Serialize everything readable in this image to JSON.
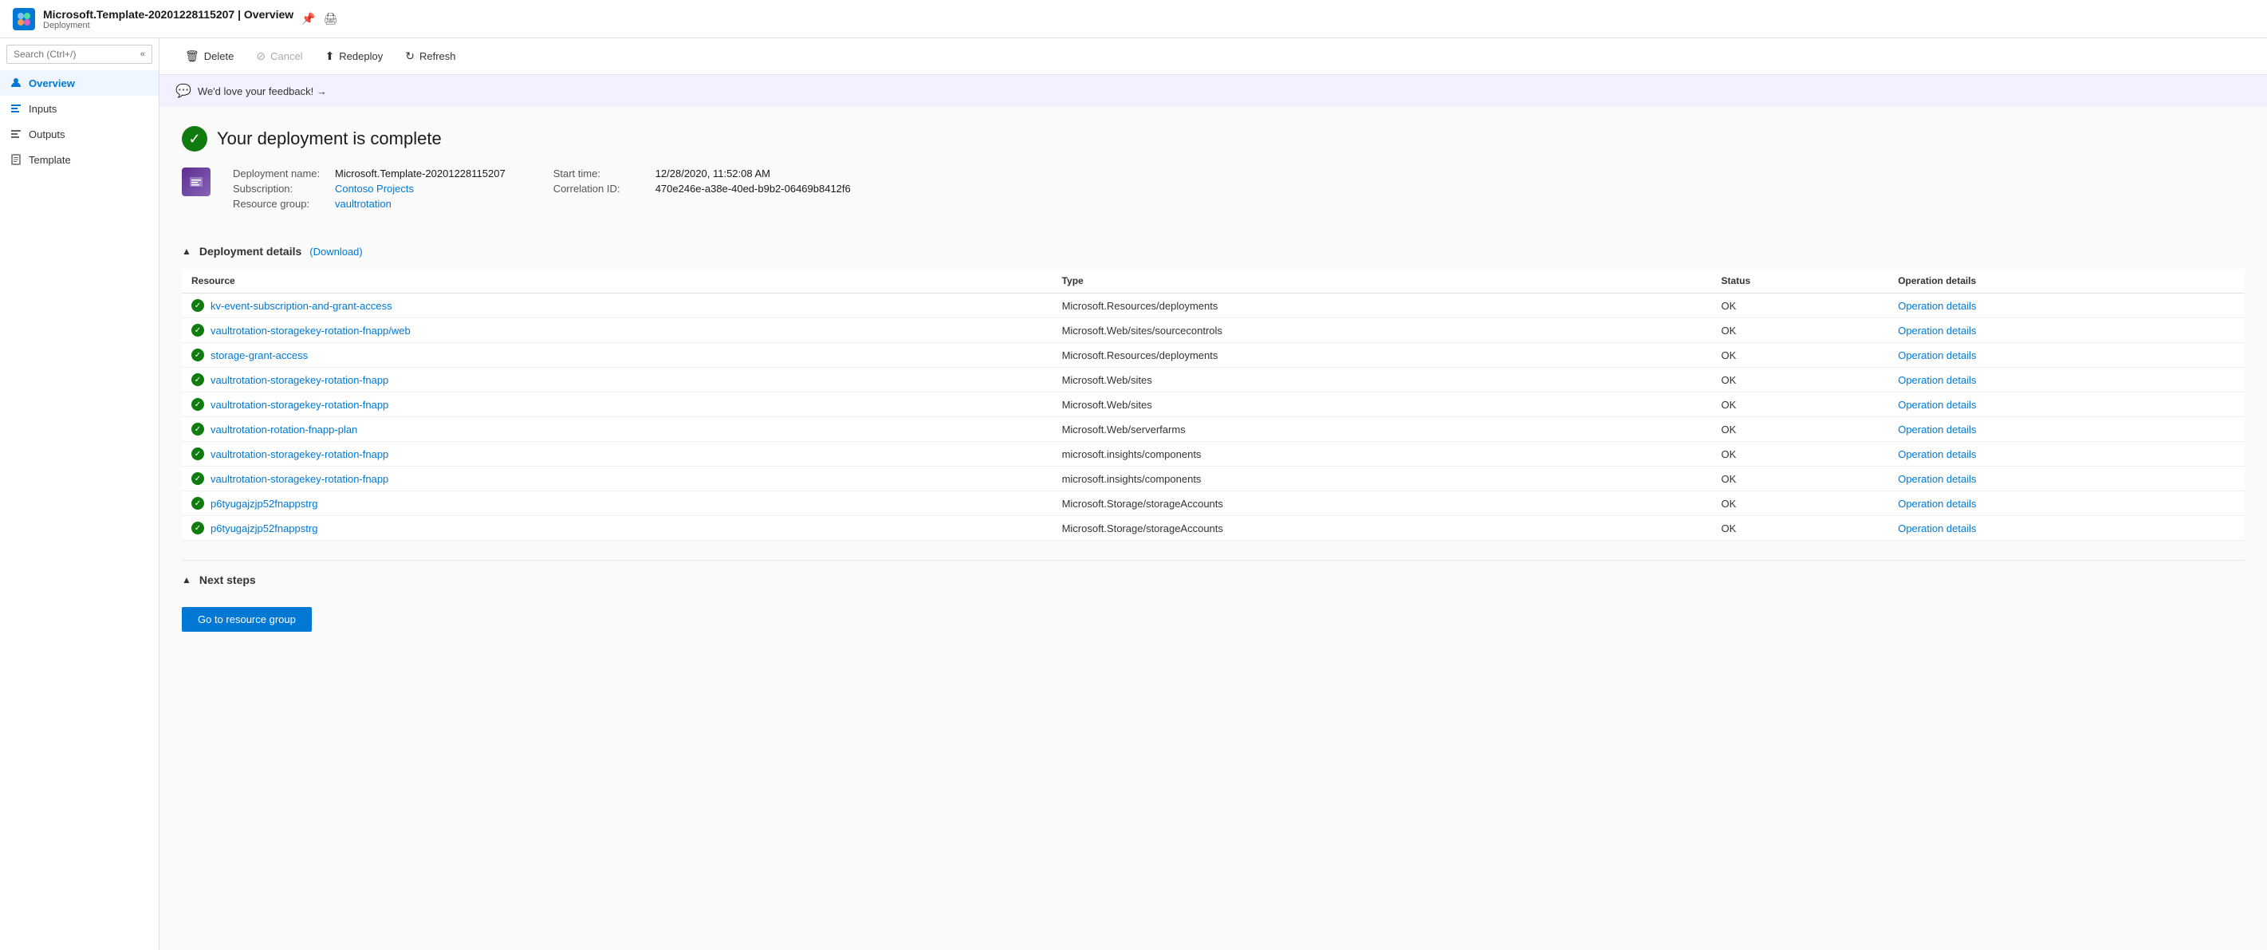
{
  "header": {
    "title": "Microsoft.Template-20201228115207 | Overview",
    "subtitle": "Deployment",
    "pin_icon": "📌",
    "print_icon": "🖨"
  },
  "toolbar": {
    "delete_label": "Delete",
    "cancel_label": "Cancel",
    "redeploy_label": "Redeploy",
    "refresh_label": "Refresh"
  },
  "feedback": {
    "text": "We'd love your feedback! →"
  },
  "sidebar": {
    "search_placeholder": "Search (Ctrl+/)",
    "items": [
      {
        "id": "overview",
        "label": "Overview",
        "active": true
      },
      {
        "id": "inputs",
        "label": "Inputs",
        "active": false
      },
      {
        "id": "outputs",
        "label": "Outputs",
        "active": false
      },
      {
        "id": "template",
        "label": "Template",
        "active": false
      }
    ]
  },
  "deployment": {
    "complete_title": "Your deployment is complete",
    "name_label": "Deployment name:",
    "name_value": "Microsoft.Template-20201228115207",
    "subscription_label": "Subscription:",
    "subscription_value": "Contoso Projects",
    "resource_group_label": "Resource group:",
    "resource_group_value": "vaultrotation",
    "start_time_label": "Start time:",
    "start_time_value": "12/28/2020, 11:52:08 AM",
    "correlation_id_label": "Correlation ID:",
    "correlation_id_value": "470e246e-a38e-40ed-b9b2-06469b8412f6"
  },
  "deployment_details": {
    "section_title": "Deployment details",
    "download_label": "(Download)",
    "columns": [
      "Resource",
      "Type",
      "Status",
      "Operation details"
    ],
    "rows": [
      {
        "resource": "kv-event-subscription-and-grant-access",
        "type": "Microsoft.Resources/deployments",
        "status": "OK",
        "operation_details": "Operation details"
      },
      {
        "resource": "vaultrotation-storagekey-rotation-fnapp/web",
        "type": "Microsoft.Web/sites/sourcecontrols",
        "status": "OK",
        "operation_details": "Operation details"
      },
      {
        "resource": "storage-grant-access",
        "type": "Microsoft.Resources/deployments",
        "status": "OK",
        "operation_details": "Operation details"
      },
      {
        "resource": "vaultrotation-storagekey-rotation-fnapp",
        "type": "Microsoft.Web/sites",
        "status": "OK",
        "operation_details": "Operation details"
      },
      {
        "resource": "vaultrotation-storagekey-rotation-fnapp",
        "type": "Microsoft.Web/sites",
        "status": "OK",
        "operation_details": "Operation details"
      },
      {
        "resource": "vaultrotation-rotation-fnapp-plan",
        "type": "Microsoft.Web/serverfarms",
        "status": "OK",
        "operation_details": "Operation details"
      },
      {
        "resource": "vaultrotation-storagekey-rotation-fnapp",
        "type": "microsoft.insights/components",
        "status": "OK",
        "operation_details": "Operation details"
      },
      {
        "resource": "vaultrotation-storagekey-rotation-fnapp",
        "type": "microsoft.insights/components",
        "status": "OK",
        "operation_details": "Operation details"
      },
      {
        "resource": "p6tyugajzjp52fnappstrg",
        "type": "Microsoft.Storage/storageAccounts",
        "status": "OK",
        "operation_details": "Operation details"
      },
      {
        "resource": "p6tyugajzjp52fnappstrg",
        "type": "Microsoft.Storage/storageAccounts",
        "status": "OK",
        "operation_details": "Operation details"
      }
    ]
  },
  "next_steps": {
    "section_title": "Next steps",
    "go_to_rg_label": "Go to resource group"
  }
}
